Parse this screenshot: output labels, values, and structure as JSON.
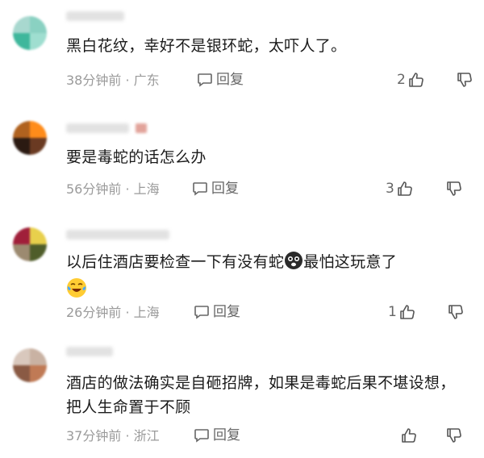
{
  "comments": [
    {
      "text": "黑白花纹，幸好不是银环蛇，太吓人了。",
      "time": "38分钟前",
      "location": "广东",
      "reply_label": "回复",
      "likes": "2",
      "avatar_colors": [
        "#a8d8cf",
        "#8ad1c2",
        "#3fb79c",
        "#9fded0"
      ]
    },
    {
      "text": "要是毒蛇的话怎么办",
      "time": "56分钟前",
      "location": "上海",
      "reply_label": "回复",
      "likes": "3",
      "avatar_colors": [
        "#b0621f",
        "#ff8c1a",
        "#2b1a12",
        "#6a3a22"
      ]
    },
    {
      "text_before_emoji": "以后住酒店要检查一下有没有蛇",
      "text_after_emoji": "最怕这玩意了",
      "time": "26分钟前",
      "location": "上海",
      "reply_label": "回复",
      "likes": "1",
      "avatar_colors": [
        "#a01f3a",
        "#e8d04c",
        "#9c8a70",
        "#4f5d2a"
      ]
    },
    {
      "text": "酒店的做法确实是自砸招牌，如果是毒蛇后果不堪设想，把人生命置于不顾",
      "time": "37分钟前",
      "location": "浙江",
      "reply_label": "回复",
      "likes": "",
      "avatar_colors": [
        "#d9c8bd",
        "#c9b2a3",
        "#8a5a44",
        "#c07a55"
      ]
    }
  ],
  "meta_separator": " · "
}
